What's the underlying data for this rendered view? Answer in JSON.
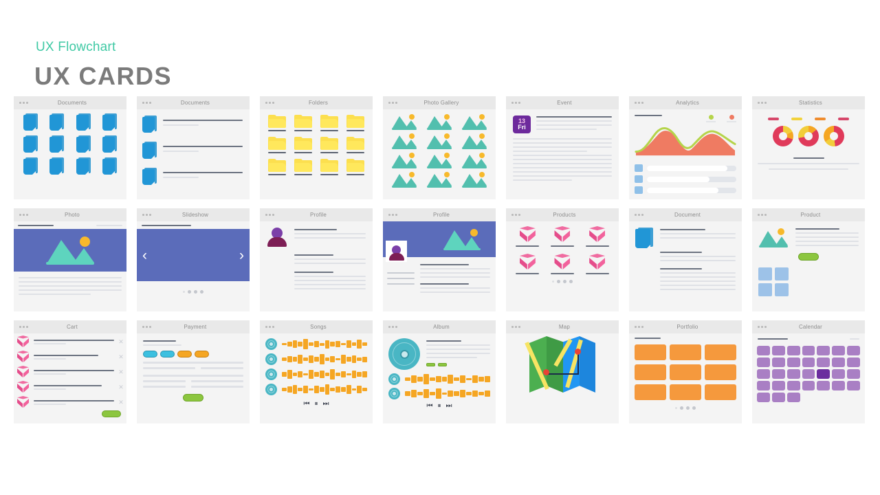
{
  "header": {
    "subtitle": "UX Flowchart",
    "title": "UX CARDS",
    "subtitle_color": "#3fc9a4",
    "title_color": "#7b7b7b"
  },
  "cards": [
    {
      "title": "Documents",
      "kind": "documents-grid"
    },
    {
      "title": "Documents",
      "kind": "documents-list"
    },
    {
      "title": "Folders",
      "kind": "folders-grid"
    },
    {
      "title": "Photo Gallery",
      "kind": "photo-gallery"
    },
    {
      "title": "Event",
      "kind": "event"
    },
    {
      "title": "Analytics",
      "kind": "analytics"
    },
    {
      "title": "Statistics",
      "kind": "statistics"
    },
    {
      "title": "Photo",
      "kind": "photo"
    },
    {
      "title": "Slideshow",
      "kind": "slideshow"
    },
    {
      "title": "Profile",
      "kind": "profile-side"
    },
    {
      "title": "Profile",
      "kind": "profile-cover"
    },
    {
      "title": "Products",
      "kind": "products"
    },
    {
      "title": "Document",
      "kind": "document-detail"
    },
    {
      "title": "Product",
      "kind": "product-detail"
    },
    {
      "title": "Cart",
      "kind": "cart"
    },
    {
      "title": "Payment",
      "kind": "payment"
    },
    {
      "title": "Songs",
      "kind": "songs"
    },
    {
      "title": "Album",
      "kind": "album"
    },
    {
      "title": "Map",
      "kind": "map"
    },
    {
      "title": "Portfolio",
      "kind": "portfolio"
    },
    {
      "title": "Calendar",
      "kind": "calendar"
    }
  ],
  "event": {
    "day_number": "13",
    "day_name": "Fri"
  },
  "analytics": {
    "legend": [
      {
        "color": "#b5d44a"
      },
      {
        "color": "#ef7b62"
      }
    ],
    "progress": [
      90,
      70,
      80
    ]
  },
  "statistics": {
    "pill_colors": [
      "#d6476a",
      "#f2d23c",
      "#ef8c2e",
      "#d6476a"
    ],
    "donut_colors": [
      "#e03a5a",
      "#f5a623",
      "#f2cd3a"
    ]
  },
  "slideshow": {
    "prev_icon": "‹",
    "next_icon": "›",
    "dot_count": 4
  },
  "payment": {
    "pills": [
      "cyan",
      "cyan",
      "orange",
      "orange"
    ]
  },
  "player": {
    "prev_icon": "⏮",
    "pause_icon": "⏸",
    "next_icon": "⏭"
  },
  "cart": {
    "item_count": 5,
    "remove_icon": "✕",
    "checkout_color": "#8cc63f"
  },
  "calendar": {
    "columns": 7,
    "full_rows": 4,
    "last_row_days": 3,
    "active_index": 18,
    "day_color": "#a97fc4",
    "active_color": "#6b2d9e"
  },
  "portfolio": {
    "tile_count": 9,
    "tile_color": "#f5993d"
  },
  "products": {
    "item_count": 6,
    "dot_count": 4
  },
  "colors": {
    "card_bg": "#f4f4f4",
    "card_header_bg": "#e9e9e9",
    "doc_blue": "#2196d6",
    "folder_yellow": "#ffe85c",
    "photo_teal": "#52bfae",
    "hero_blue": "#5b6cba",
    "product_pink": "#f06ba0",
    "disc_teal": "#49b6c4",
    "wave_orange": "#f5a623"
  }
}
